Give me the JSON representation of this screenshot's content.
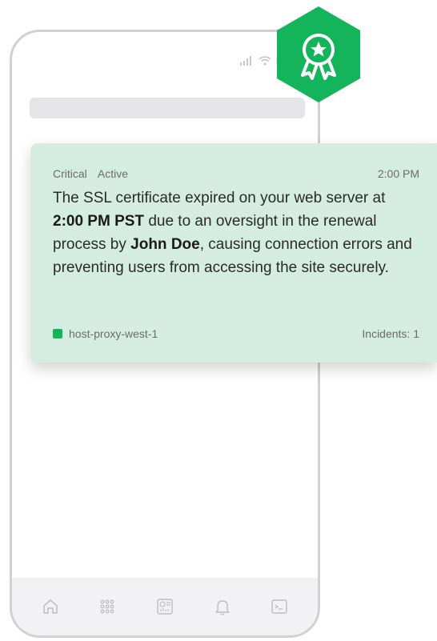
{
  "colors": {
    "brand": "#14b45a",
    "card_bg": "#d5ede1",
    "phone_border": "#d1d1d3"
  },
  "status_bar": {
    "icons": [
      "signal-icon",
      "wifi-icon",
      "battery-icon"
    ]
  },
  "badge": {
    "icon": "award-ribbon-icon"
  },
  "alert": {
    "severity": "Critical",
    "state": "Active",
    "time": "2:00 PM",
    "message_parts": {
      "p1": "The SSL certificate expired on your web server at ",
      "b1": "2:00 PM PST",
      "p2": " due to an oversight in the renewal process by ",
      "b2": "John Doe",
      "p3": ", causing connection errors and preventing users from accessing the site securely."
    },
    "host": "host-proxy-west-1",
    "incidents": "Incidents: 1"
  },
  "tabbar": {
    "items": [
      "home-icon",
      "apps-grid-icon",
      "dashboard-icon",
      "bell-icon",
      "terminal-icon"
    ]
  }
}
